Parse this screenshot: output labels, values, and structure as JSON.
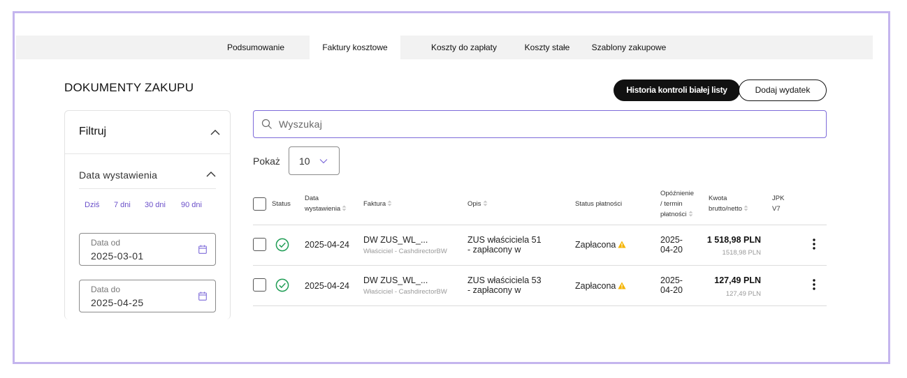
{
  "tabs": [
    "Podsumowanie",
    "Faktury kosztowe",
    "Koszty do zapłaty",
    "Koszty stałe",
    "Szablony zakupowe"
  ],
  "active_tab": "Faktury kosztowe",
  "page_title": "DOKUMENTY ZAKUPU",
  "buttons": {
    "whitelist_history": "Historia kontroli białej listy",
    "add_expense": "Dodaj wydatek"
  },
  "filter": {
    "title": "Filtruj",
    "section_title": "Data wystawienia",
    "quick_ranges": [
      "Dziś",
      "7 dni",
      "30 dni",
      "90 dni"
    ],
    "date_from": {
      "label": "Data od",
      "value": "2025-03-01"
    },
    "date_to": {
      "label": "Data do",
      "value": "2025-04-25"
    }
  },
  "search": {
    "placeholder": "Wyszukaj",
    "value": ""
  },
  "page_size": {
    "label": "Pokaż",
    "value": "10"
  },
  "table": {
    "headers": {
      "status": "Status",
      "issue_date_1": "Data",
      "issue_date_2": "wystawienia",
      "invoice": "Faktura",
      "description": "Opis",
      "payment_status": "Status płatności",
      "delay_1": "Opóźnienie",
      "delay_2": "/ termin",
      "delay_3": "płatności",
      "amount_1": "Kwota",
      "amount_2": "brutto/netto",
      "jpk_1": "JPK",
      "jpk_2": "V7"
    },
    "rows": [
      {
        "issue_date": "2025-04-24",
        "invoice": "DW ZUS_WL_...",
        "invoice_sub": "Właściciel - CashdirectorBW",
        "description_1": "ZUS właściciela 51",
        "description_2": "- zapłacony w",
        "payment_status": "Zapłacona",
        "due_1": "2025-",
        "due_2": "04-20",
        "gross": "1 518,98 PLN",
        "net": "1518,98 PLN"
      },
      {
        "issue_date": "2025-04-24",
        "invoice": "DW ZUS_WL_...",
        "invoice_sub": "Właściciel - CashdirectorBW",
        "description_1": "ZUS właściciela 53",
        "description_2": "- zapłacony w",
        "payment_status": "Zapłacona",
        "due_1": "2025-",
        "due_2": "04-20",
        "gross": "127,49 PLN",
        "net": "127,49 PLN"
      }
    ]
  },
  "colors": {
    "accent_purple": "#6a4fc9",
    "frame_border": "#c4b5ee",
    "status_ok": "#1f9d55",
    "warning": "#f5b400"
  }
}
